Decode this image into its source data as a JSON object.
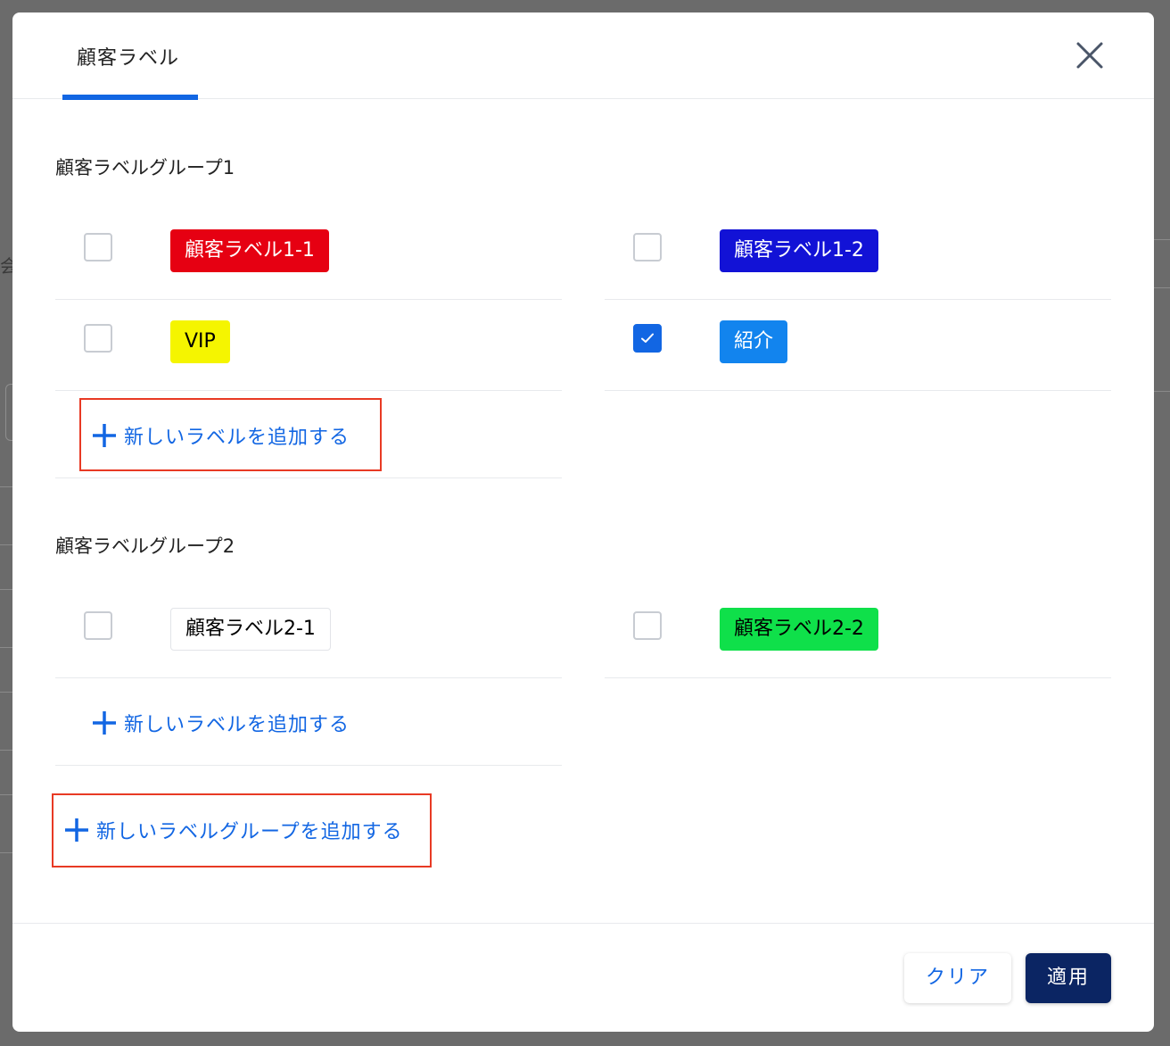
{
  "background": {
    "fragment_text": "会"
  },
  "dialog": {
    "tab_label": "顧客ラベル",
    "close_icon": "close-icon"
  },
  "groups": [
    {
      "title": "顧客ラベルグループ1",
      "labels": [
        {
          "text": "顧客ラベル1-1",
          "checked": false,
          "bg": "#e60012",
          "fg": "#ffffff"
        },
        {
          "text": "顧客ラベル1-2",
          "checked": false,
          "bg": "#1212d6",
          "fg": "#ffffff"
        },
        {
          "text": "VIP",
          "checked": false,
          "bg": "#f5f500",
          "fg": "#000000"
        },
        {
          "text": "紹介",
          "checked": true,
          "bg": "#1284ee",
          "fg": "#ffffff"
        }
      ],
      "add_label": "新しいラベルを追加する"
    },
    {
      "title": "顧客ラベルグループ2",
      "labels": [
        {
          "text": "顧客ラベル2-1",
          "checked": false,
          "bg": "#ffffff",
          "fg": "#000000"
        },
        {
          "text": "顧客ラベル2-2",
          "checked": false,
          "bg": "#0fe04a",
          "fg": "#000000"
        }
      ],
      "add_label": "新しいラベルを追加する"
    }
  ],
  "add_group_label": "新しいラベルグループを追加する",
  "footer": {
    "clear_label": "クリア",
    "apply_label": "適用"
  },
  "colors": {
    "accent": "#1266e3",
    "primary_button": "#0b2563",
    "highlight_box": "#e83a24"
  }
}
